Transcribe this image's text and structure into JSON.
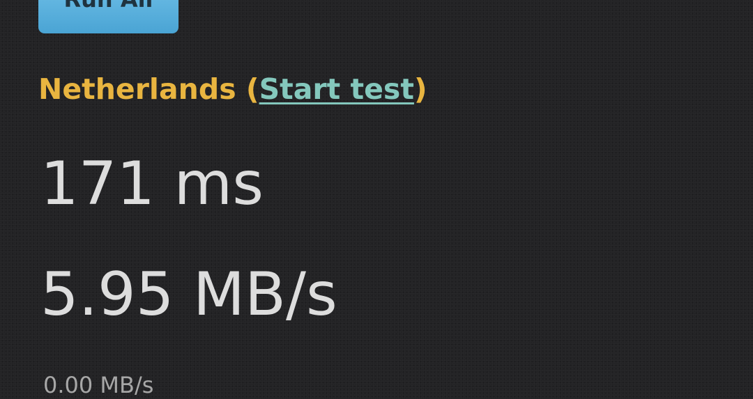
{
  "toolbar": {
    "run_all_label": "Run All"
  },
  "region": {
    "name": "Netherlands",
    "open_paren": " (",
    "start_test_label": "Start test",
    "close_paren": ")"
  },
  "results": {
    "latency": "171 ms",
    "throughput": "5.95 MB/s",
    "secondary_throughput": "0.00 MB/s"
  },
  "colors": {
    "accent_button": "#5aaede",
    "heading": "#e9b540",
    "link": "#84c8bd",
    "metric_text": "#dddddd",
    "background": "#232325"
  }
}
